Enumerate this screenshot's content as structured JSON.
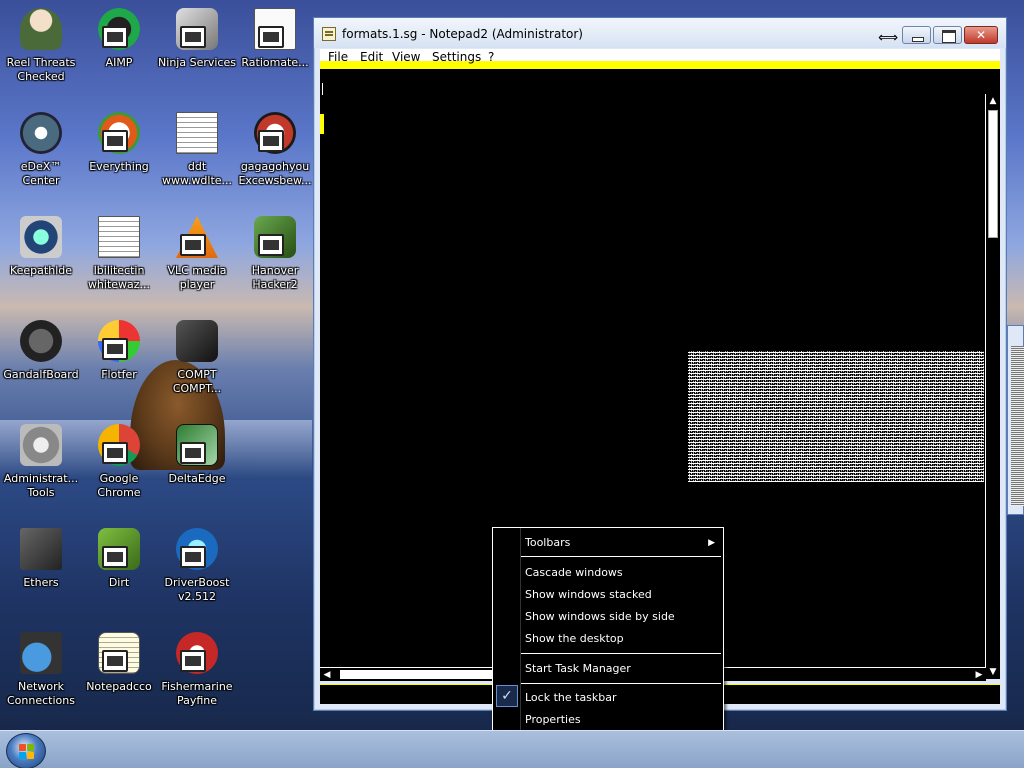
{
  "desktop": {
    "icons": [
      {
        "id": "icon-0",
        "label": "Reel Threats Checked"
      },
      {
        "id": "icon-1",
        "label": "AIMP"
      },
      {
        "id": "icon-2",
        "label": "Ninja Services"
      },
      {
        "id": "icon-3",
        "label": "Ratiomate..."
      },
      {
        "id": "icon-4",
        "label": "eDeX™ Center"
      },
      {
        "id": "icon-5",
        "label": "Everything"
      },
      {
        "id": "icon-6",
        "label": "ddt www.wdlte..."
      },
      {
        "id": "icon-7",
        "label": "gagagohyou Excewsbew..."
      },
      {
        "id": "icon-8",
        "label": "Keepathlde"
      },
      {
        "id": "icon-9",
        "label": "Ibilitectin whitewaz..."
      },
      {
        "id": "icon-10",
        "label": "VLC media player"
      },
      {
        "id": "icon-11",
        "label": "Hanover Hacker2"
      },
      {
        "id": "icon-12",
        "label": "GandalfBoard"
      },
      {
        "id": "icon-13",
        "label": "Flotfer"
      },
      {
        "id": "icon-14",
        "label": "COMPT COMPT..."
      },
      {
        "id": "icon-15",
        "label": "Administrat... Tools"
      },
      {
        "id": "icon-16",
        "label": "Google Chrome"
      },
      {
        "id": "icon-17",
        "label": "DeltaEdge"
      },
      {
        "id": "icon-18",
        "label": "Ethers"
      },
      {
        "id": "icon-19",
        "label": "Dirt"
      },
      {
        "id": "icon-20",
        "label": "DriverBoost v2.512"
      },
      {
        "id": "icon-21",
        "label": "Network Connections"
      },
      {
        "id": "icon-22",
        "label": "Notepadcco"
      },
      {
        "id": "icon-23",
        "label": "Fishermarine Payfine"
      }
    ]
  },
  "window": {
    "title": "formats.1.sg - Notepad2 (Administrator)",
    "close_glyph": "✕",
    "menu": [
      "File",
      "Edit",
      "View",
      "Settings",
      "?"
    ]
  },
  "context_menu": {
    "toolbars": "Toolbars",
    "cascade": "Cascade windows",
    "stacked": "Show windows stacked",
    "side_by_side": "Show windows side by side",
    "show_desktop": "Show the desktop",
    "task_manager": "Start Task Manager",
    "lock_taskbar": "Lock the taskbar",
    "properties": "Properties",
    "submenu_arrow": "▶",
    "check": "✓"
  },
  "scroll": {
    "up": "▲",
    "down": "▼",
    "left": "◀",
    "right": "▶"
  },
  "colors": {
    "accent_yellow": "#ffff00",
    "menu_bg": "#000000",
    "editor_bg": "#000000",
    "close_red": "#c0392b"
  },
  "icons_semantic": {
    "start": "windows-start-orb",
    "check": "checkmark-icon",
    "submenu": "chevron-right-icon"
  }
}
